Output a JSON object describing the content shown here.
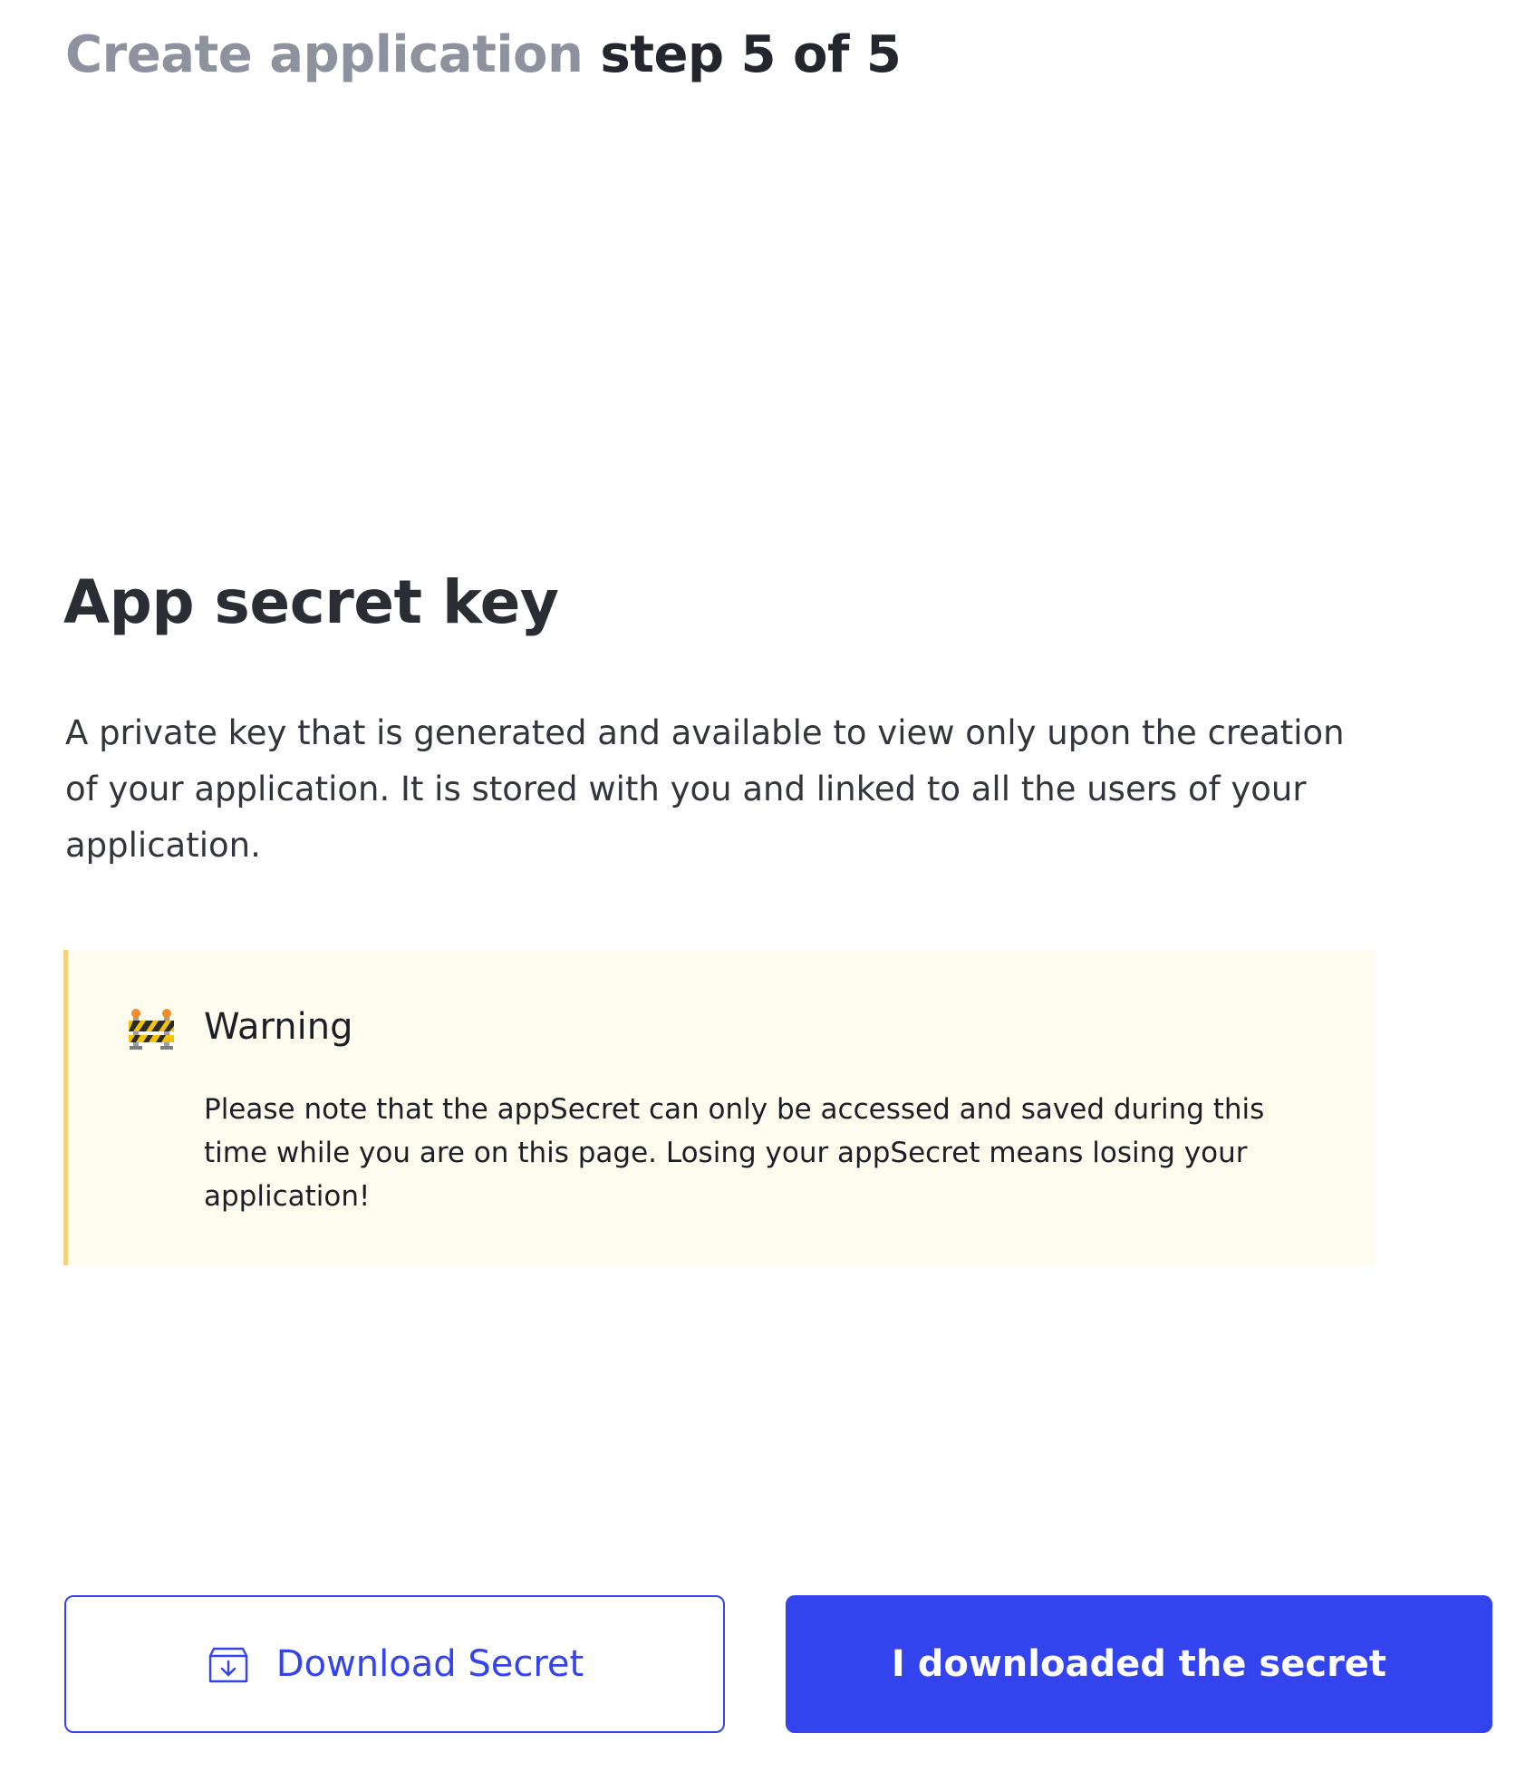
{
  "header": {
    "title_muted": "Create application",
    "title_step": "step 5 of 5"
  },
  "section": {
    "title": "App secret key",
    "description": "A private key that is generated and available to view only upon the creation of your application. It is stored with you and linked to all the users of your application."
  },
  "warning": {
    "icon": "construction-barrier-icon",
    "title": "Warning",
    "text": "Please note that the appSecret can only be accessed and saved during this time while you are on this page. Losing your appSecret means losing your application!"
  },
  "actions": {
    "download_label": "Download Secret",
    "download_icon": "download-box-icon",
    "confirm_label": "I downloaded the secret"
  },
  "colors": {
    "primary": "#3344ee",
    "warning_bg": "#fefbef",
    "warning_border": "#f3d27a",
    "muted_text": "#8e929f"
  }
}
